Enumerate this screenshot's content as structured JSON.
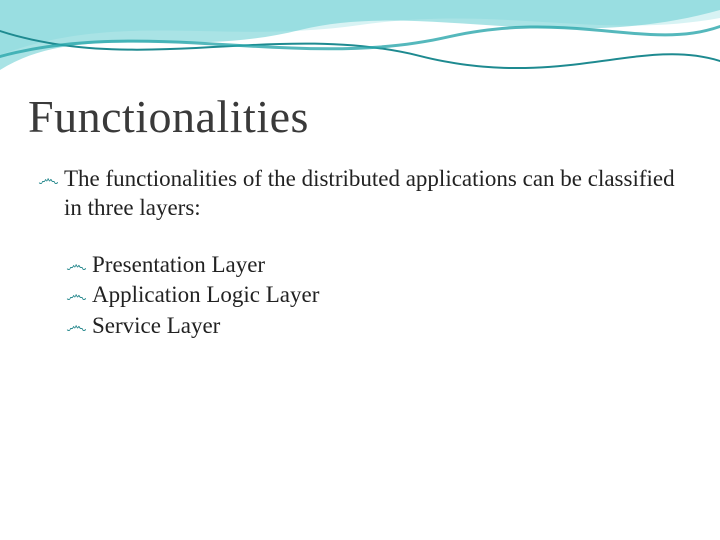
{
  "title": "Functionalities",
  "intro": "The functionalities of the distributed applications can be classified in three layers:",
  "layers": [
    "Presentation Layer",
    "Application Logic Layer",
    "Service Layer"
  ],
  "bullet_glyph": "෴",
  "theme": {
    "accent": "#2a8a8f",
    "wave_light": "#9fe3e6",
    "wave_mid": "#4fbcc2",
    "wave_dark": "#1e7e85"
  }
}
